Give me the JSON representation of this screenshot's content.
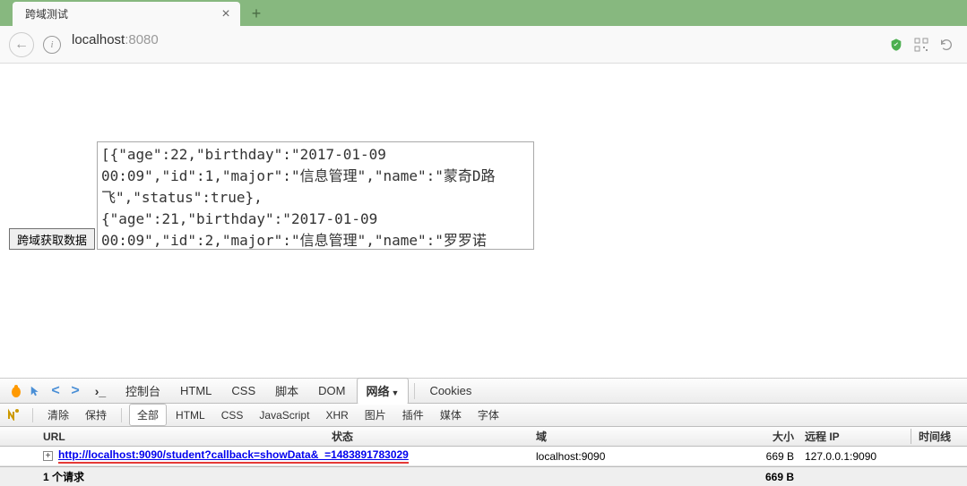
{
  "browser": {
    "tab_title": "跨域测试",
    "url_host": "localhost",
    "url_port": ":8080"
  },
  "page": {
    "button_label": "跨域获取数据",
    "textarea_value": "[{\"age\":22,\"birthday\":\"2017-01-09 00:09\",\"id\":1,\"major\":\"信息管理\",\"name\":\"蒙奇D路飞\",\"status\":true},\n{\"age\":21,\"birthday\":\"2017-01-09 00:09\",\"id\":2,\"major\":\"信息管理\",\"name\":\"罗罗诺"
  },
  "devtools": {
    "tabs": {
      "console": "控制台",
      "html": "HTML",
      "css": "CSS",
      "script": "脚本",
      "dom": "DOM",
      "network": "网络",
      "cookies": "Cookies"
    },
    "subactions": {
      "clear": "清除",
      "persist": "保持"
    },
    "filters": {
      "all": "全部",
      "html": "HTML",
      "css": "CSS",
      "js": "JavaScript",
      "xhr": "XHR",
      "images": "图片",
      "plugins": "插件",
      "media": "媒体",
      "fonts": "字体"
    },
    "columns": {
      "url": "URL",
      "status": "状态",
      "domain": "域",
      "size": "大小",
      "remote_ip": "远程 IP",
      "timeline": "时间线"
    },
    "request": {
      "url": "http://localhost:9090/student?callback=showData&_=1483891783029",
      "domain": "localhost:9090",
      "size": "669 B",
      "remote_ip": "127.0.0.1:9090"
    },
    "summary": {
      "label": "1 个请求",
      "total_size": "669 B"
    }
  },
  "chart_data": {
    "type": "table",
    "title": "Network Requests",
    "columns": [
      "URL",
      "状态",
      "域",
      "大小",
      "远程 IP"
    ],
    "rows": [
      [
        "http://localhost:9090/student?callback=showData&_=1483891783029",
        "",
        "localhost:9090",
        "669 B",
        "127.0.0.1:9090"
      ]
    ],
    "summary": {
      "requests": 1,
      "total_size": "669 B"
    }
  }
}
